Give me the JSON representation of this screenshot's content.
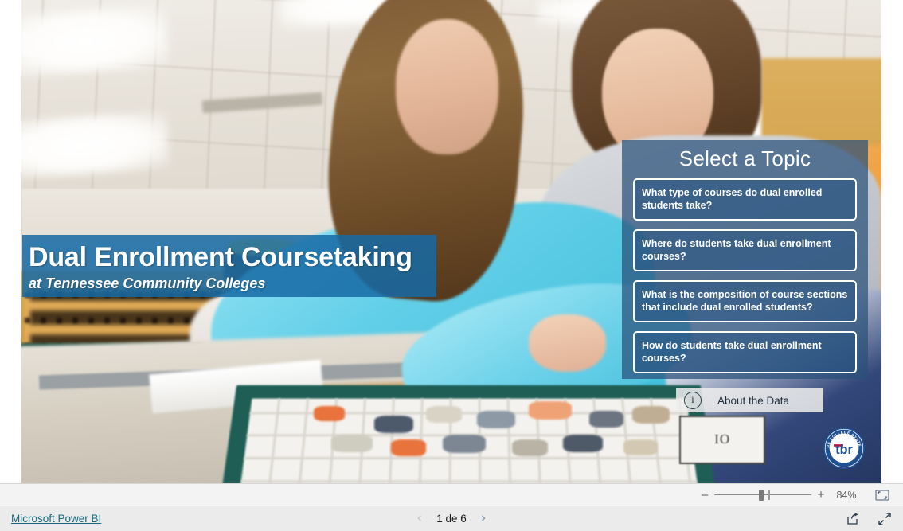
{
  "report": {
    "title_main": "Dual Enrollment Coursetaking",
    "title_sub": "at Tennessee Community Colleges",
    "image_sign_text": "IO",
    "colors": {
      "title_banner": "#166aa5",
      "topic_panel": "#29507a",
      "topic_button": "#285483",
      "link_teal": "#16697c",
      "logo_blue": "#1d4f91",
      "logo_red": "#c8102e"
    }
  },
  "topic_panel": {
    "heading": "Select a Topic",
    "buttons": [
      {
        "label": "What type of courses do dual enrolled students take?"
      },
      {
        "label": "Where do students take dual enrollment courses?"
      },
      {
        "label": "What is the composition of course sections that include dual enrolled students?"
      },
      {
        "label": "How do students take dual enrollment courses?"
      }
    ]
  },
  "about": {
    "label": "About the Data",
    "icon": "info-icon"
  },
  "logo": {
    "wordmark": "tbr",
    "ring_top": "THE COLLEGE SYSTEM",
    "ring_bottom": "OF TENNESSEE"
  },
  "zoom_bar": {
    "minus": "–",
    "plus": "+",
    "percent": "84%",
    "fit_icon": "fit-to-page-icon"
  },
  "status_bar": {
    "brand_link": "Microsoft Power BI",
    "page_label": "1 de 6",
    "prev_icon": "chevron-left-icon",
    "next_icon": "chevron-right-icon",
    "share_icon": "share-icon",
    "fullscreen_icon": "fullscreen-icon"
  }
}
